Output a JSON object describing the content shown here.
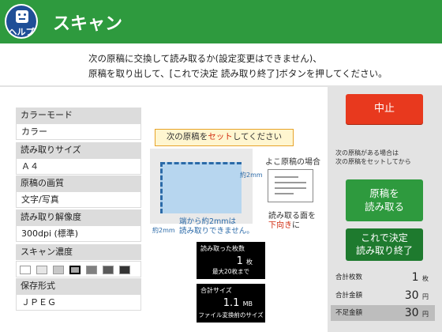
{
  "header": {
    "help_label": "ヘルプ",
    "title": "スキャン"
  },
  "instruction": {
    "line1": "次の原稿に交換して読み取るか(設定変更はできません)、",
    "line2": "原稿を取り出して、[これで決定 読み取り終了]ボタンを押してください。"
  },
  "settings": [
    {
      "label": "カラーモード",
      "value": "カラー"
    },
    {
      "label": "読み取りサイズ",
      "value": "Ａ４"
    },
    {
      "label": "原稿の画質",
      "value": "文字/写真"
    },
    {
      "label": "読み取り解像度",
      "value": "300dpi (標準)"
    },
    {
      "label": "スキャン濃度"
    },
    {
      "label": "保存形式",
      "value": "ＪＰＥＧ"
    }
  ],
  "density": {
    "levels": [
      "#ffffff",
      "#e6e6e6",
      "#c8c8c8",
      "#a8a8a8",
      "#808080",
      "#5a5a5a",
      "#333333"
    ],
    "selected_index": 3
  },
  "diagram": {
    "callout_prefix": "次の原稿を",
    "callout_highlight": "セット",
    "callout_suffix": "してください",
    "margin_label_right": "約2mm",
    "margin_label_bottom": "約2mm",
    "edge_note_line1": "端から約2mmは",
    "edge_note_line2": "読み取りできません。",
    "landscape_label": "よこ原稿の場合",
    "face_line1": "読み取る面を",
    "face_highlight": "下向き",
    "face_suffix": "に"
  },
  "counters": {
    "scanned": {
      "title": "読み取った枚数",
      "value": "1",
      "unit": "枚",
      "note": "最大20枚まで"
    },
    "size": {
      "title": "合計サイズ",
      "value": "1.1",
      "unit": "MB",
      "note": "ファイル変換前のサイズ"
    }
  },
  "actions": {
    "stop_label": "中止",
    "next_note_line1": "次の原稿がある場合は",
    "next_note_line2": "次の原稿をセットしてから",
    "read_line1": "原稿を",
    "read_line2": "読み取る",
    "finish_line1": "これで決定",
    "finish_line2": "読み取り終了"
  },
  "totals": [
    {
      "label": "合計枚数",
      "value": "1",
      "unit": "枚"
    },
    {
      "label": "合計金額",
      "value": "30",
      "unit": "円"
    },
    {
      "label": "不足金額",
      "value": "30",
      "unit": "円"
    }
  ],
  "colors": {
    "header": "#2e9a3e",
    "stop": "#e8391e",
    "read": "#2e9a3e",
    "finish": "#1e7a2e",
    "help": "#1f4f97"
  }
}
